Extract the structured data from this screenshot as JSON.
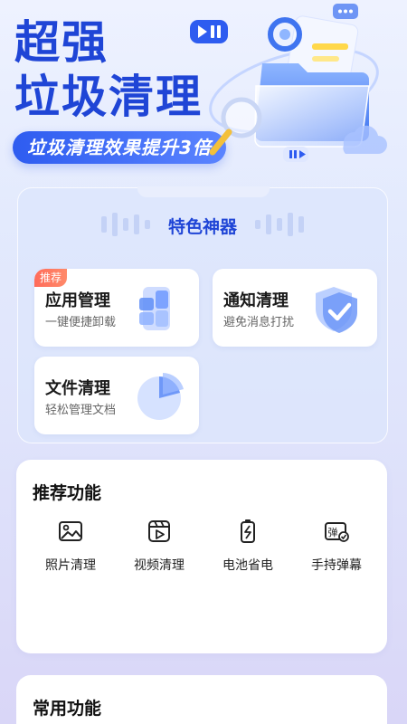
{
  "hero": {
    "title_line1": "超强",
    "title_line2": "垃圾清理",
    "subtitle": "垃圾清理效果提升3倍"
  },
  "feature_panel": {
    "title": "特色神器",
    "cards": [
      {
        "title": "应用管理",
        "subtitle": "一键便捷卸载",
        "badge": "推荐",
        "icon": "app-manage-icon"
      },
      {
        "title": "通知清理",
        "subtitle": "避免消息打扰",
        "icon": "shield-check-icon"
      },
      {
        "title": "文件清理",
        "subtitle": "轻松管理文档",
        "icon": "pie-file-icon"
      }
    ]
  },
  "recommended": {
    "title": "推荐功能",
    "items": [
      {
        "label": "照片清理",
        "icon": "photo-icon"
      },
      {
        "label": "视频清理",
        "icon": "video-icon"
      },
      {
        "label": "电池省电",
        "icon": "battery-icon"
      },
      {
        "label": "手持弹幕",
        "icon": "danmaku-icon"
      }
    ]
  },
  "common": {
    "title": "常用功能"
  },
  "colors": {
    "brand_blue": "#1f45d6",
    "badge_red": "#ff6b5a"
  }
}
